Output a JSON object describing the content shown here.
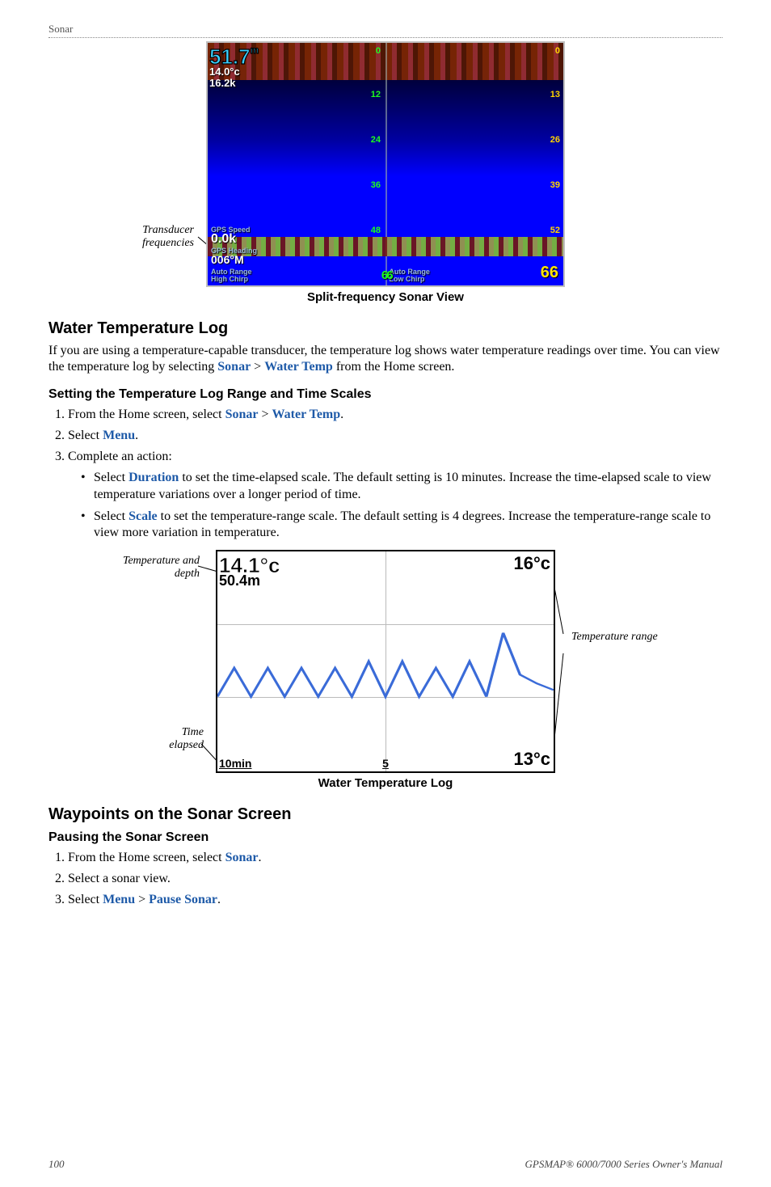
{
  "running_head": "Sonar",
  "fig1": {
    "depth_primary": "51.7",
    "depth_unit": "m",
    "depth_sub1": "14.0°c",
    "depth_sub2": "16.2k",
    "gps_speed_label": "GPS Speed",
    "gps_speed_value": "0.0k",
    "gps_heading_label": "GPS Heading",
    "gps_heading_value": "006°M",
    "auto_range_l1": "Auto Range",
    "auto_range_l2": "High Chirp",
    "auto_range_r1": "Auto Range",
    "auto_range_r2": "Low Chirp",
    "left_panel_depth": "66",
    "right_panel_depth": "66",
    "left_ticks": [
      "0",
      "12",
      "24",
      "36",
      "48"
    ],
    "right_ticks": [
      "0",
      "13",
      "26",
      "39",
      "52"
    ],
    "callout": "Transducer frequencies",
    "caption": "Split-frequency Sonar View"
  },
  "section1": {
    "title": "Water Temperature Log",
    "body_prefix": "If you are using a temperature-capable transducer, the temperature log shows water temperature readings over time. You can view the temperature log by selecting ",
    "path_sonar": "Sonar",
    "path_sep": " > ",
    "path_watertemp": "Water Temp",
    "body_suffix": " from the Home screen."
  },
  "sub1": {
    "title": "Setting the Temperature Log Range and Time Scales",
    "step1_pre": "From the Home screen, select ",
    "step1_sonar": "Sonar",
    "step1_sep": " > ",
    "step1_wt": "Water Temp",
    "step1_post": ".",
    "step2_pre": "Select ",
    "step2_menu": "Menu",
    "step2_post": ".",
    "step3": "Complete an action:",
    "bullet1_pre": "Select ",
    "bullet1_key": "Duration",
    "bullet1_post": " to set the time-elapsed scale. The default setting is 10 minutes. Increase the time-elapsed scale to view temperature variations over a longer period of time.",
    "bullet2_pre": "Select ",
    "bullet2_key": "Scale",
    "bullet2_post": " to set the temperature-range scale. The default setting is 4 degrees. Increase the temperature-range scale to view more variation in temperature."
  },
  "fig2": {
    "temp_current": "14.1°c",
    "depth_current": "50.4m",
    "range_top": "16°c",
    "range_bottom": "13°c",
    "elapsed_axis_start": "10min",
    "elapsed_axis_mid": "5",
    "callout_td": "Temperature and depth",
    "callout_range": "Temperature range",
    "callout_time": "Time elapsed",
    "caption": "Water Temperature Log"
  },
  "chart_data": {
    "type": "line",
    "title": "Water Temperature Log",
    "xlabel": "Time elapsed (min)",
    "ylabel": "Temperature (°C)",
    "ylim": [
      13,
      16
    ],
    "x": [
      10,
      9.5,
      9,
      8.5,
      8,
      7.5,
      7,
      6.5,
      6,
      5.5,
      5,
      4.5,
      4,
      3.5,
      3,
      2.5,
      2,
      1.5,
      1,
      0.5,
      0
    ],
    "values": [
      14.0,
      14.4,
      14.0,
      14.4,
      14.0,
      14.4,
      14.0,
      14.4,
      14.0,
      14.5,
      14.0,
      14.5,
      14.0,
      14.4,
      14.0,
      14.5,
      14.0,
      14.9,
      14.3,
      14.2,
      14.1
    ]
  },
  "section2": {
    "title": "Waypoints on the Sonar Screen"
  },
  "sub2": {
    "title": "Pausing the Sonar Screen",
    "step1_pre": "From the Home screen, select ",
    "step1_sonar": "Sonar",
    "step1_post": ".",
    "step2": "Select a sonar view.",
    "step3_pre": "Select ",
    "step3_menu": "Menu",
    "step3_sep": " > ",
    "step3_pause": "Pause Sonar",
    "step3_post": "."
  },
  "footer": {
    "page": "100",
    "book": "GPSMAP® 6000/7000 Series Owner's Manual"
  }
}
